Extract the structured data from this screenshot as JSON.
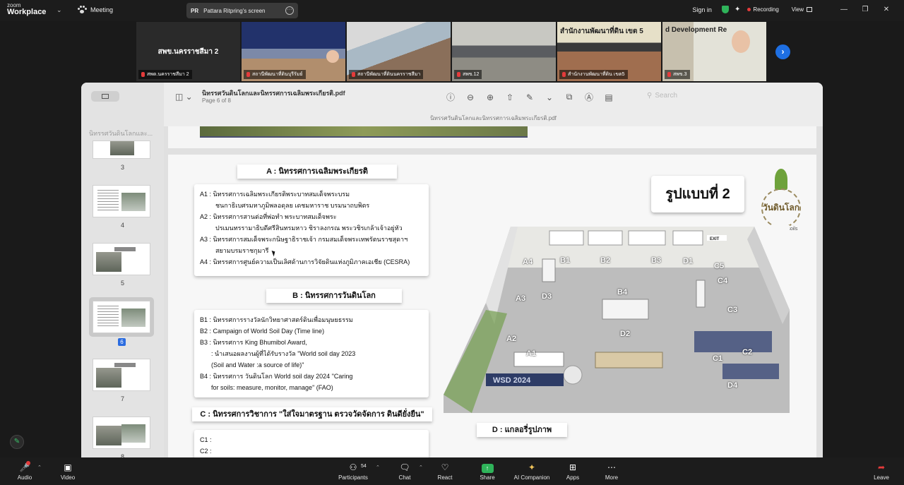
{
  "app": {
    "brand_line1": "zoom",
    "brand_line2": "Workplace",
    "meeting_label": "Meeting"
  },
  "screen_share": {
    "initials": "PR",
    "label": "Pattara Ritpring's screen"
  },
  "top_right": {
    "sign_in": "Sign in",
    "recording": "Recording",
    "view": "View"
  },
  "participants": [
    {
      "name": "สพข.นครราชสีมา 2",
      "display": "สพด.นครราชสีมา 2"
    },
    {
      "name": "สถานีพัฒนาที่ดินบุรีรัมย์"
    },
    {
      "name": "สถานีพัฒนาที่ดินนครราชสีมา"
    },
    {
      "name": "สพข.12"
    },
    {
      "name": "สำนักงานพัฒนาที่ดิน เขต5",
      "sign": "สำนักงานพัฒนาที่ดิน เขต 5"
    },
    {
      "name": "สพข.3",
      "sign": "d Development Re"
    }
  ],
  "pdf": {
    "title": "นิทรรศวันดินโลกและนิทรรศการเฉลิมพระเกียรติ.pdf",
    "page_info": "Page 6 of 8",
    "subtitle": "นิทรรศวันดินโลกและนิทรรศการเฉลิมพระเกียรติ.pdf",
    "search_placeholder": "Search",
    "sidebar_title": "นิทรรศวันดินโลกและ...",
    "thumb_pages": [
      "3",
      "4",
      "5",
      "6",
      "7",
      "8"
    ],
    "current_page": "6"
  },
  "page6": {
    "section_a": {
      "header": "A : นิทรรศการเฉลิมพระเกียรติ",
      "lines": [
        "A1 : นิทรรศการเฉลิมพระเกียรติพระบาทสมเด็จพระบรม",
        "ชนกาธิเบศรมหาภูมิพลอดุลย เดชมหาราช บรมนาถบพิตร",
        "A2 : นิทรรศการสานต่อที่พ่อทำ พระบาทสมเด็จพระ",
        "ปรเมนทรรามาธิบดีศรีสินทรมหาว ชิราลงกรณ พระวชิรเกล้าเจ้าอยู่หัว",
        "A3 : นิทรรศการสมเด็จพระกนิษฐาธิราชเจ้า กรมสมเด็จพระเทพรัตนราชสุดาฯ",
        "สยามบรมราชกุมารี",
        "A4 : นิทรรศการศูนย์ความเป็นเลิศด้านการวิจัยดินแห่งภูมิภาคเอเชีย (CESRA)"
      ]
    },
    "section_b": {
      "header": "B : นิทรรศการวันดินโลก",
      "lines": [
        "B1 : นิทรรศการรางวัลนักวิทยาศาสตร์ดินเพื่อมนุษยธรรม",
        "B2 : Campaign of World Soil Day (Time line)",
        "B3 : นิทรรศการ King Bhumibol Award,",
        ": นำเสนอผลงานผู้ที่ได้รับรางวัล \"World soil day 2023",
        "(Soil and Water :a source of life)\"",
        "B4 : นิทรรศการ วันดินโลก World soil day 2024 \"Caring",
        "for soils: measure, monitor, manage\" (FAO)"
      ]
    },
    "section_c": {
      "header": "C : นิทรรศการวิชาการ \"ใส่ใจมาตรฐาน ตรวจวัดจัดการ ดินดียั่งยืน\"",
      "lines": [
        "C1 :",
        "C2 :"
      ]
    },
    "section_d": {
      "header": "D : แกลอรี่รูปภาพ"
    },
    "model_title": "รูปแบบที่ 2",
    "logo_text": "วันดินโลก",
    "logo_sub": "Caring for soils",
    "floor_labels": [
      "A4",
      "B1",
      "B2",
      "B3",
      "D1",
      "C5",
      "C4",
      "A3",
      "D3",
      "B4",
      "C3",
      "D2",
      "A2",
      "A1",
      "C1",
      "C2",
      "D4"
    ],
    "floor_banner": "WSD 2024",
    "exit_sign": "EXIT"
  },
  "bottom": {
    "audio": "Audio",
    "video": "Video",
    "participants": "Participants",
    "participant_count": "54",
    "chat": "Chat",
    "react": "React",
    "share": "Share",
    "ai": "AI Companion",
    "apps": "Apps",
    "more": "More",
    "leave": "Leave"
  },
  "colors": {
    "accent": "#1e6fe2",
    "recording": "#e43b3b",
    "share_green": "#2fb35a",
    "page_badge": "#2b6ce0"
  }
}
